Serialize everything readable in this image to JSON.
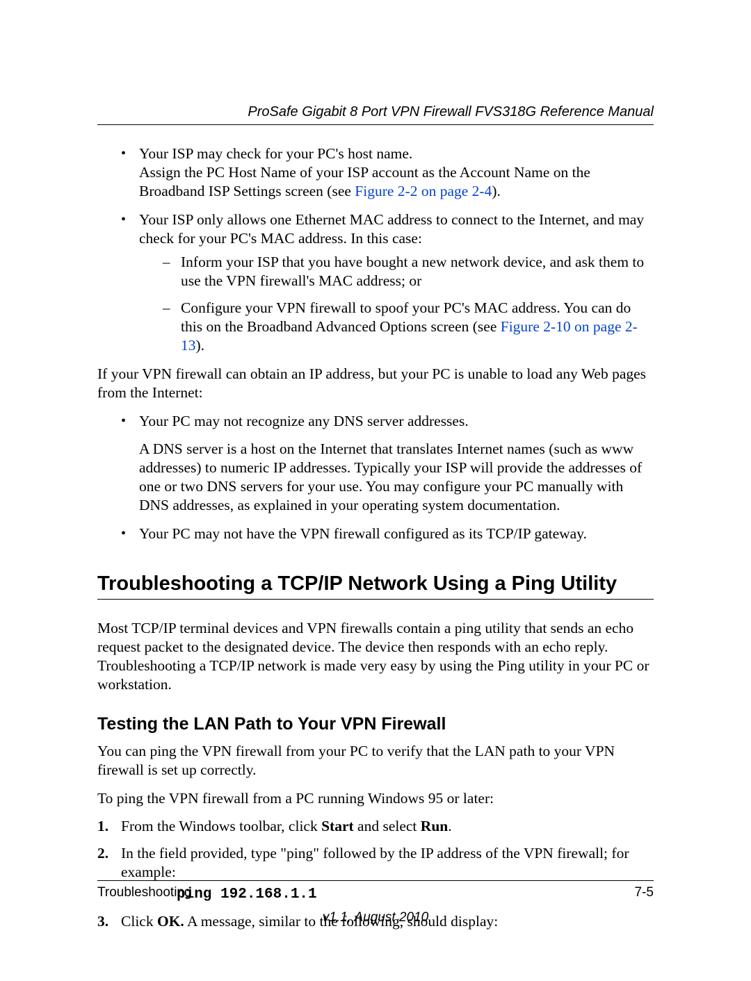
{
  "running_header": "ProSafe Gigabit 8 Port VPN Firewall FVS318G Reference Manual",
  "bullets_top": [
    {
      "line1": "Your ISP may check for your PC's host name.",
      "line2a": "Assign the PC Host Name of your ISP account as the Account Name on the Broadband ISP Settings screen (see ",
      "link": "Figure 2-2 on page 2-4",
      "line2b": ")."
    },
    {
      "intro": "Your ISP only allows one Ethernet MAC address to connect to the Internet, and may check for your PC's MAC address. In this case:",
      "dashes": [
        "Inform your ISP that you have bought a new network device, and ask them to use the VPN firewall's MAC address; or",
        {
          "pre": "Configure your VPN firewall to spoof your PC's MAC address. You can do this on the Broadband Advanced Options screen (see ",
          "link": "Figure 2-10 on page 2-13",
          "post": ")."
        }
      ]
    }
  ],
  "para_if": "If your VPN firewall can obtain an IP address, but your PC is unable to load any Web pages from the Internet:",
  "bullets_bottom": [
    {
      "lead": "Your PC may not recognize any DNS server addresses.",
      "detail": "A DNS server is a host on the Internet that translates Internet names (such as www addresses) to numeric IP addresses. Typically your ISP will provide the addresses of one or two DNS servers for your use. You may configure your PC manually with DNS addresses, as explained in your operating system documentation."
    },
    {
      "lead": "Your PC may not have the VPN firewall configured as its TCP/IP gateway."
    }
  ],
  "section_heading": "Troubleshooting a TCP/IP Network Using a Ping Utility",
  "section_para": "Most TCP/IP terminal devices and VPN firewalls contain a ping utility that sends an echo request packet to the designated device. The device then responds with an echo reply. Troubleshooting a TCP/IP network is made very easy by using the Ping utility in your PC or workstation.",
  "subheading": "Testing the LAN Path to Your VPN Firewall",
  "sub_para1": "You can ping the VPN firewall from your PC to verify that the LAN path to your VPN firewall is set up correctly.",
  "sub_para2": "To ping the VPN firewall from a PC running Windows 95 or later:",
  "steps": {
    "s1_pre": "From the Windows toolbar, click ",
    "s1_b1": "Start",
    "s1_mid": " and select ",
    "s1_b2": "Run",
    "s1_post": ".",
    "s2": "In the field provided, type \"ping\" followed by the IP address of the VPN firewall; for example:",
    "cmd": "ping 192.168.1.1",
    "s3_pre": "Click ",
    "s3_b": "OK.",
    "s3_post": " A message, similar to the following, should display:"
  },
  "footer": {
    "left": "Troubleshooting",
    "right": "7-5",
    "version": "v1.1, August 2010"
  },
  "nums": {
    "n1": "1.",
    "n2": "2.",
    "n3": "3."
  }
}
